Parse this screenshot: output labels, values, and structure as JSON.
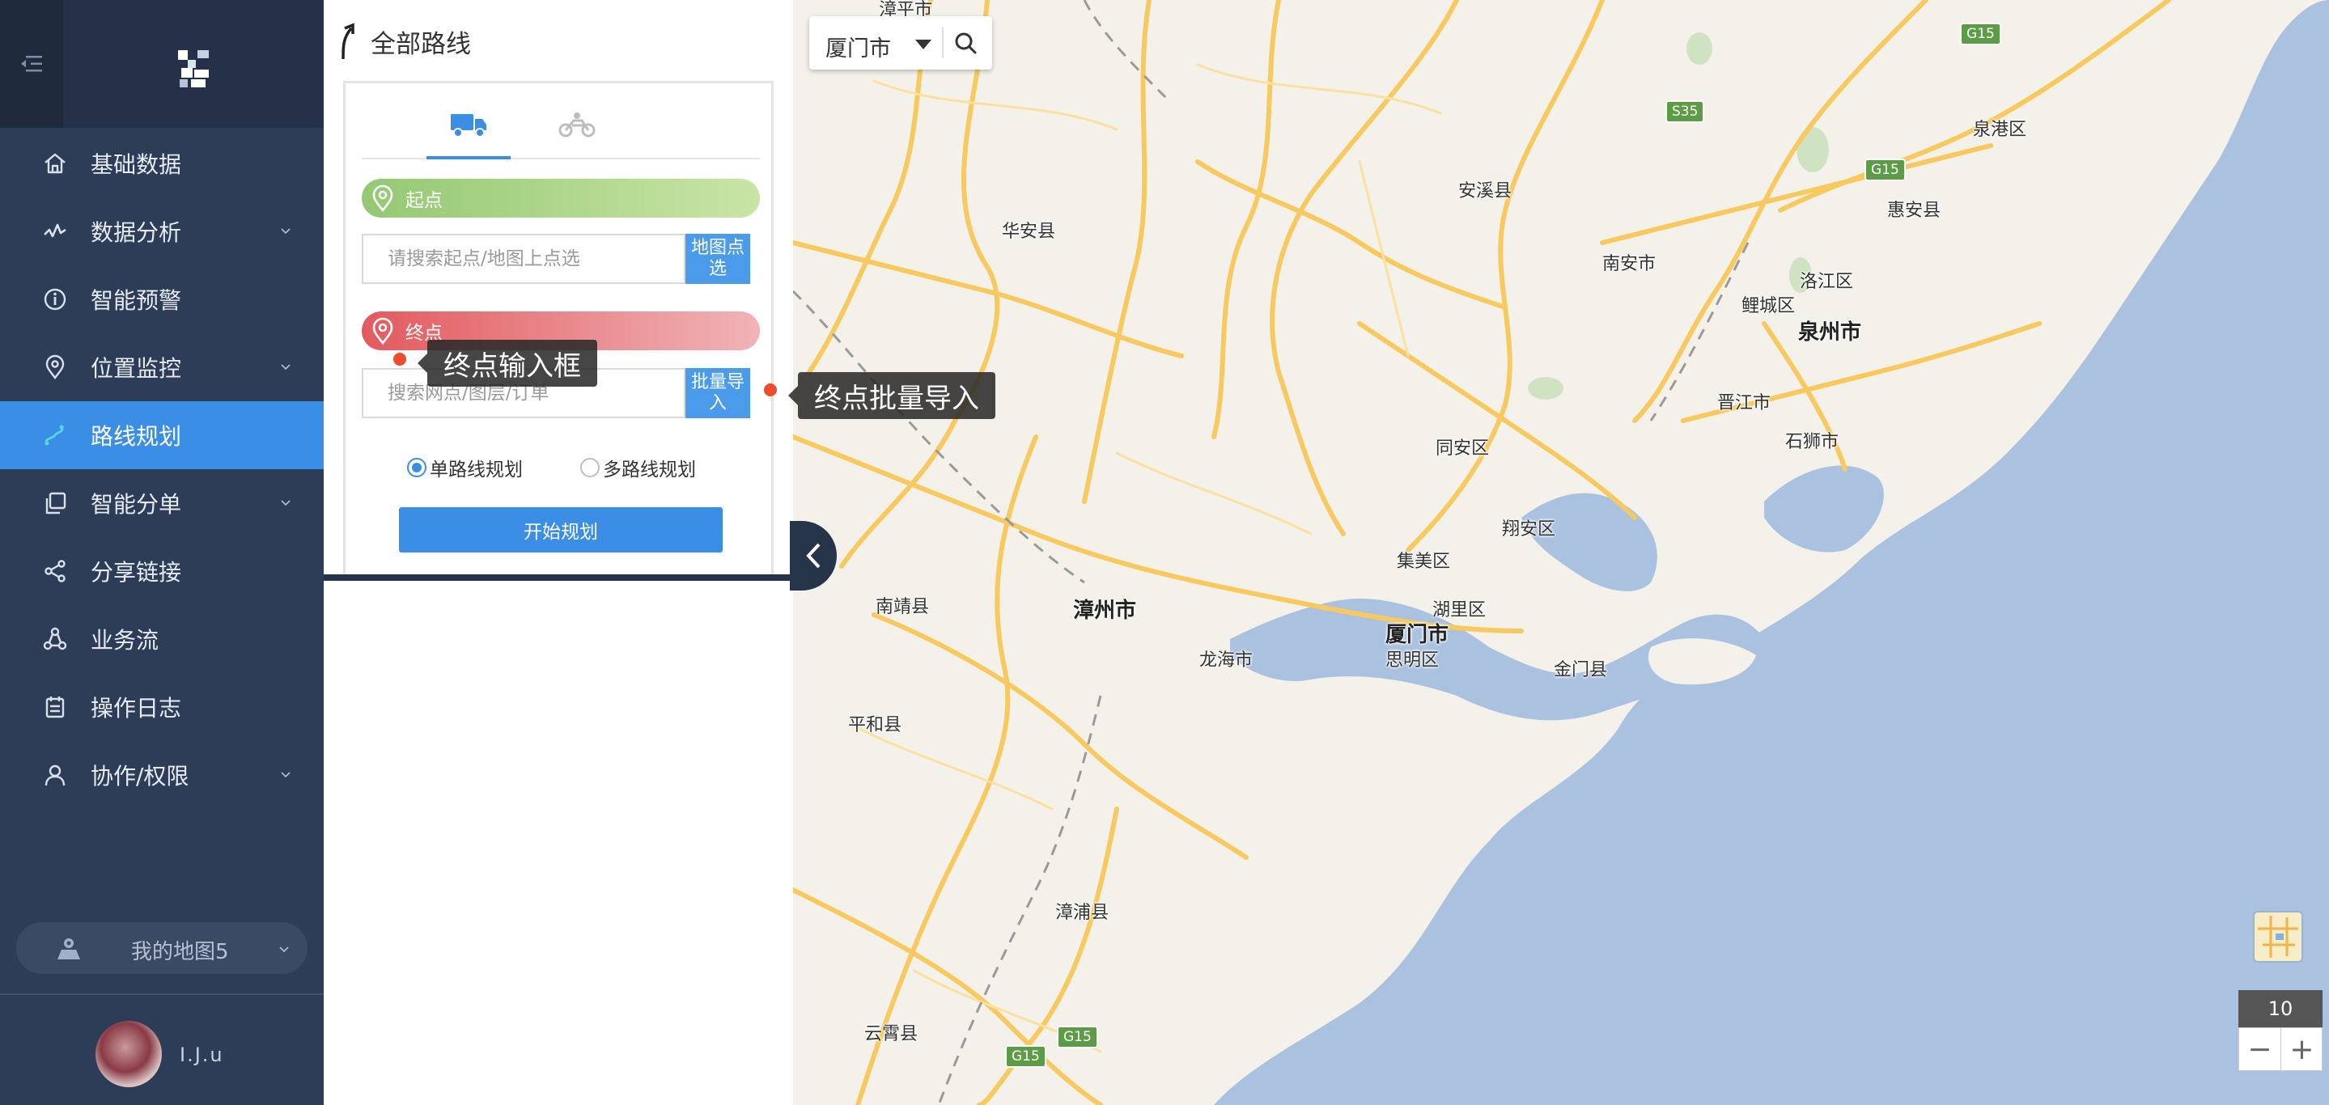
{
  "sidebar": {
    "items": [
      {
        "label": "基础数据",
        "icon": "home-icon",
        "has_submenu": false,
        "active": false
      },
      {
        "label": "数据分析",
        "icon": "trend-icon",
        "has_submenu": true,
        "active": false
      },
      {
        "label": "智能预警",
        "icon": "info-icon",
        "has_submenu": false,
        "active": false
      },
      {
        "label": "位置监控",
        "icon": "location-pin-icon",
        "has_submenu": true,
        "active": false
      },
      {
        "label": "路线规划",
        "icon": "route-icon",
        "has_submenu": false,
        "active": true
      },
      {
        "label": "智能分单",
        "icon": "copy-icon",
        "has_submenu": true,
        "active": false
      },
      {
        "label": "分享链接",
        "icon": "share-icon",
        "has_submenu": false,
        "active": false
      },
      {
        "label": "业务流",
        "icon": "workflow-icon",
        "has_submenu": false,
        "active": false
      },
      {
        "label": "操作日志",
        "icon": "calendar-log-icon",
        "has_submenu": false,
        "active": false
      },
      {
        "label": "协作/权限",
        "icon": "user-icon",
        "has_submenu": true,
        "active": false
      }
    ],
    "my_map": "我的地图5",
    "username": "I.J.u"
  },
  "panel": {
    "title": "全部路线",
    "start": {
      "label": "起点",
      "placeholder": "请搜索起点/地图上点选",
      "button": "地图点选"
    },
    "end": {
      "label": "终点",
      "placeholder": "搜索网点/图层/订单",
      "button": "批量导入"
    },
    "radio": {
      "single": "单路线规划",
      "multi": "多路线规划",
      "selected": "single"
    },
    "start_button": "开始规划"
  },
  "tooltips": {
    "end_input": "终点输入框",
    "batch_import": "终点批量导入"
  },
  "map": {
    "city": "厦门市",
    "zoom": "10",
    "zoom_out": "−",
    "zoom_in": "+",
    "labels": {
      "zhangpingshi": "漳平市",
      "huaan": "华安县",
      "anxi": "安溪县",
      "nanan": "南安市",
      "quangang": "泉港区",
      "huian": "惠安县",
      "luojiang": "洛江区",
      "licheng": "鲤城区",
      "quanzhou": "泉州市",
      "jinjiang": "晋江市",
      "shishi": "石狮市",
      "tongan": "同安区",
      "xiangan": "翔安区",
      "jimei": "集美区",
      "huli": "湖里区",
      "xiamen": "厦门市",
      "siming": "思明区",
      "jinmen": "金门县",
      "nanjing": "南靖县",
      "zhangzhou": "漳州市",
      "longhai": "龙海市",
      "pinghe": "平和县",
      "zhangpu": "漳浦县",
      "yunxiao": "云霄县"
    },
    "highways": {
      "g15_a": "G15",
      "g15_b": "G15",
      "s35": "S35",
      "g15_c": "G15",
      "g15_d": "G15"
    },
    "colors": {
      "land": "#f3f1ea",
      "sea": "#aac2e0",
      "road": "#f7c95e",
      "accent": "#3a8ee6"
    }
  }
}
